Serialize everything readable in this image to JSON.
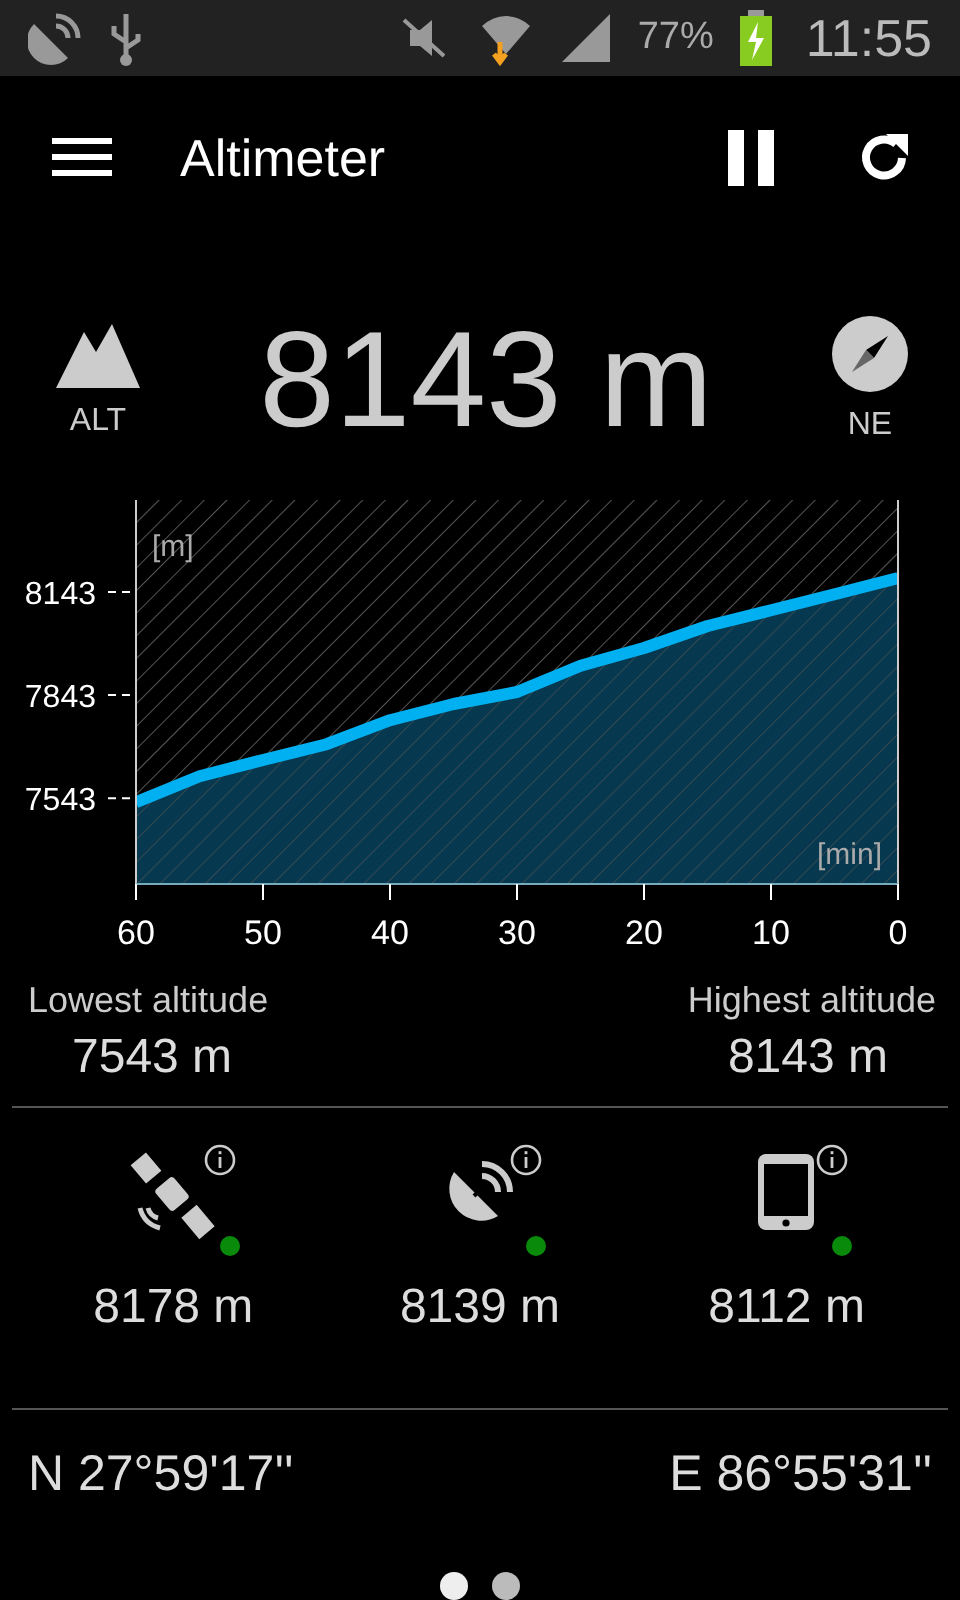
{
  "status_bar": {
    "battery": "77%",
    "time": "11:55"
  },
  "app_bar": {
    "title": "Altimeter"
  },
  "altitude": {
    "label": "ALT",
    "value": "8143 m",
    "heading": "NE"
  },
  "chart": {
    "chart_data": {
      "type": "area",
      "xlabel": "[min]",
      "ylabel": "[m]",
      "x": [
        60,
        55,
        50,
        45,
        40,
        35,
        30,
        25,
        20,
        15,
        10,
        5,
        0
      ],
      "series": [
        {
          "color": "#00b0f0",
          "values": [
            7531,
            7607,
            7654,
            7700,
            7770,
            7817,
            7852,
            7928,
            7980,
            8044,
            8090,
            8137,
            8184
          ]
        }
      ],
      "xlim": [
        60,
        0
      ],
      "ylim": [
        7293,
        8411
      ],
      "xticks": [
        60,
        50,
        40,
        30,
        20,
        10,
        0
      ],
      "yticks": [
        7543,
        7843,
        8143
      ]
    }
  },
  "range": {
    "lowest_label": "Lowest altitude",
    "lowest": "7543 m",
    "highest_label": "Highest altitude",
    "highest": "8143 m"
  },
  "sources": [
    {
      "kind": "satellite",
      "value": "8178 m",
      "color": "#0a8a0a"
    },
    {
      "kind": "dish",
      "value": "8139 m",
      "color": "#0a8a0a"
    },
    {
      "kind": "phone",
      "value": "8112 m",
      "color": "#0a8a0a"
    }
  ],
  "coordinates": {
    "latitude": "N 27°59'17''",
    "longitude": "E 86°55'31''"
  },
  "pages": [
    {
      "selected": true
    },
    {
      "selected": false
    }
  ]
}
